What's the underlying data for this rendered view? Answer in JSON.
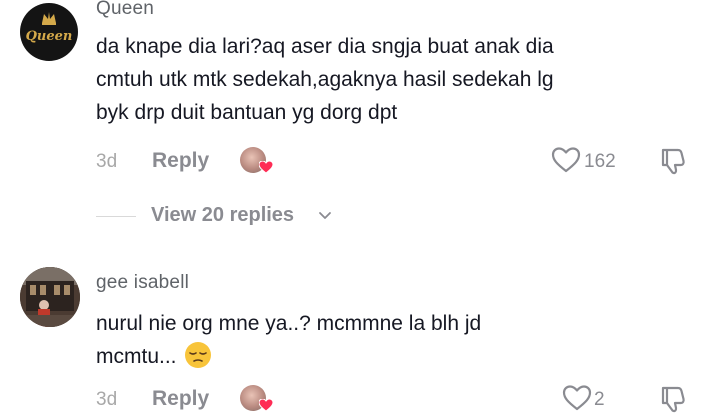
{
  "comments": [
    {
      "username": "Queen",
      "avatar_text": "Queen",
      "avatar_colors": {
        "bg": "#141414",
        "text": "#d4a94a"
      },
      "lines": [
        "da knape dia lari?aq aser dia sngja buat anak dia",
        "cmtuh utk mtk sedekah,agaknya hasil sedekah lg",
        "byk drp duit bantuan yg dorg dpt"
      ],
      "time": "3d",
      "reply_label": "Reply",
      "likes": "162"
    },
    {
      "username": "gee isabell",
      "lines": [
        "nurul nie org mne ya..? mcmmne la blh jd",
        "mcmtu..."
      ],
      "emoji": "😔",
      "time": "3d",
      "reply_label": "Reply",
      "likes": "2"
    }
  ],
  "view_replies": {
    "label": "View 20 replies"
  },
  "colors": {
    "heart_badge": "#fe2c55",
    "text_primary": "#161823",
    "text_secondary": "#8a8b91"
  }
}
